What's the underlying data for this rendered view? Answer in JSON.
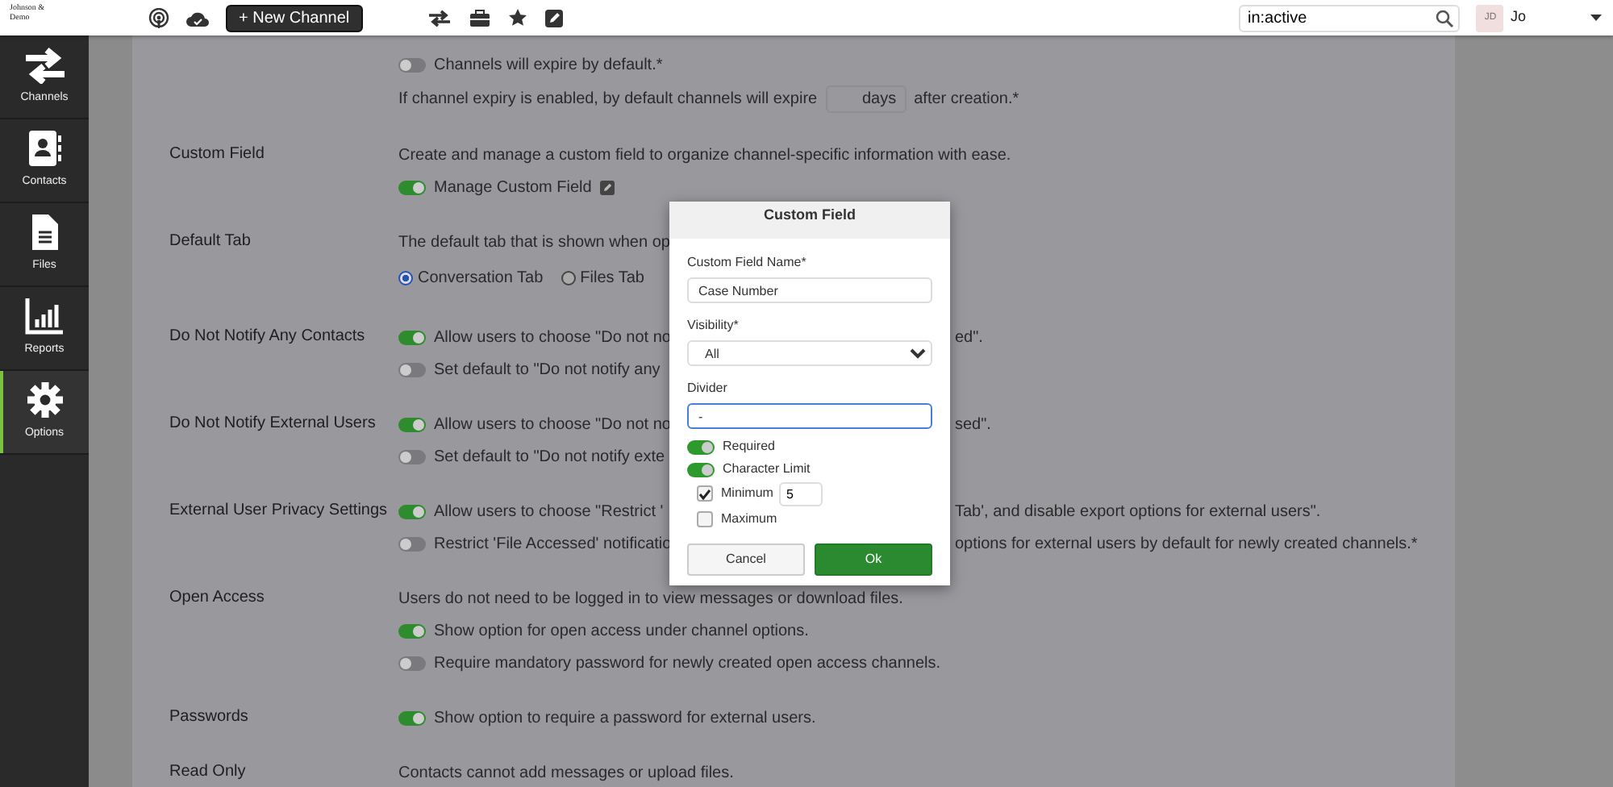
{
  "header": {
    "logo_text": "Johnson & Demo",
    "new_button": "+ New Channel",
    "search": {
      "value": "in:active"
    },
    "user": {
      "initials": "JD",
      "name": "Jo"
    }
  },
  "sidebar": {
    "items": [
      {
        "label": "Channels",
        "kind": "arrows",
        "selected": false
      },
      {
        "label": "Contacts",
        "kind": "contacts",
        "selected": false
      },
      {
        "label": "Files",
        "kind": "file",
        "selected": false
      },
      {
        "label": "Reports",
        "kind": "chart",
        "selected": false
      },
      {
        "label": "Options",
        "kind": "gear",
        "selected": true
      }
    ]
  },
  "settings": [
    {
      "lines": [
        {
          "kind": "toggle",
          "on": false,
          "text": "Channels will expire by default.*"
        },
        {
          "kind": "expiry",
          "text": "If channel expiry is enabled, by default channels will expire",
          "unit": "days",
          "text_after": "after creation.*"
        }
      ]
    },
    {
      "label": "Custom Field",
      "lines": [
        {
          "kind": "text",
          "text": "Create and manage a custom field to organize channel-specific information with ease."
        },
        {
          "kind": "toggle",
          "on": true,
          "text": "Manage Custom Field",
          "edit": true
        }
      ]
    },
    {
      "label": "Default Tab",
      "lines": [
        {
          "kind": "text",
          "text": "The default tab that is shown when op"
        },
        {
          "kind": "radios",
          "options": [
            {
              "label": "Conversation Tab",
              "selected": true
            },
            {
              "label": "Files Tab",
              "selected": false
            }
          ]
        }
      ]
    },
    {
      "label": "Do Not Notify Any Contacts",
      "lines": [
        {
          "kind": "toggle",
          "on": true,
          "text": "Allow users to choose \"Do not no",
          "text_right": "ed\"."
        },
        {
          "kind": "toggle",
          "on": false,
          "text": "Set default to \"Do not notify any"
        }
      ]
    },
    {
      "label": "Do Not Notify External Users",
      "lines": [
        {
          "kind": "toggle",
          "on": true,
          "text": "Allow users to choose \"Do not no",
          "text_right": "sed\"."
        },
        {
          "kind": "toggle",
          "on": false,
          "text": "Set default to \"Do not notify exte"
        }
      ]
    },
    {
      "label": "External User Privacy Settings",
      "lines": [
        {
          "kind": "toggle",
          "on": true,
          "text": "Allow users to choose \"Restrict '",
          "text_right": "Tab', and disable export options for external users\"."
        },
        {
          "kind": "toggle",
          "on": false,
          "text": "Restrict 'File Accessed' notificatio",
          "text_right": "options for external users by default for newly created channels.*"
        }
      ]
    },
    {
      "label": "Open Access",
      "lines": [
        {
          "kind": "text",
          "text": "Users do not need to be logged in to view messages or download files."
        },
        {
          "kind": "toggle",
          "on": true,
          "text": "Show option for open access under channel options."
        },
        {
          "kind": "toggle",
          "on": false,
          "text": "Require mandatory password for newly created open access channels."
        }
      ]
    },
    {
      "label": "Passwords",
      "lines": [
        {
          "kind": "toggle",
          "on": true,
          "text": "Show option to require a password for external users."
        }
      ]
    },
    {
      "label": "Read Only",
      "lines": [
        {
          "kind": "text",
          "text": "Contacts cannot add messages or upload files."
        }
      ]
    }
  ],
  "modal": {
    "title": "Custom Field",
    "fields": [
      {
        "kind": "text",
        "label": "Custom Field Name*",
        "value": "Case Number",
        "focused": false
      },
      {
        "kind": "select",
        "label": "Visibility*",
        "value": "All",
        "focused": false
      },
      {
        "kind": "text",
        "label": "Divider",
        "value": "-",
        "focused": true
      }
    ],
    "toggles": [
      {
        "label": "Required",
        "on": true
      },
      {
        "label": "Character Limit",
        "on": true
      }
    ],
    "checks": [
      {
        "label": "Minimum",
        "checked": true,
        "value": "5"
      },
      {
        "label": "Maximum",
        "checked": false
      }
    ],
    "buttons": [
      {
        "label": "Cancel",
        "kind": "secondary"
      },
      {
        "label": "Ok",
        "kind": "primary"
      }
    ]
  }
}
